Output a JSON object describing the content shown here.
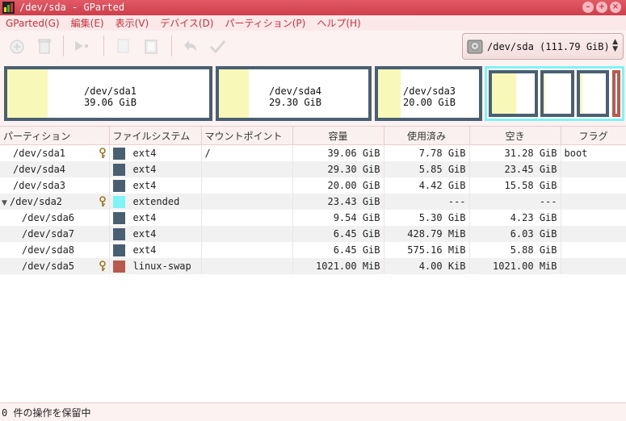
{
  "window": {
    "title": "/dev/sda - GParted"
  },
  "menu": [
    "GParted(G)",
    "編集(E)",
    "表示(V)",
    "デバイス(D)",
    "パーティション(P)",
    "ヘルプ(H)"
  ],
  "device_selector": {
    "value": "/dev/sda  (111.79 GiB)"
  },
  "map": {
    "sda1": {
      "name": "/dev/sda1",
      "size": "39.06 GiB",
      "used_fraction": 0.2
    },
    "sda4": {
      "name": "/dev/sda4",
      "size": "29.30 GiB",
      "used_fraction": 0.2
    },
    "sda3": {
      "name": "/dev/sda3",
      "size": "20.00 GiB",
      "used_fraction": 0.22
    }
  },
  "table": {
    "headers": [
      "パーティション",
      "ファイルシステム",
      "マウントポイント",
      "容量",
      "使用済み",
      "空き",
      "フラグ"
    ],
    "rows": [
      {
        "partition": "/dev/sda1",
        "fs": "ext4",
        "mount": "/",
        "size": "39.06 GiB",
        "used": "7.78 GiB",
        "free": "31.28 GiB",
        "flags": "boot"
      },
      {
        "partition": "/dev/sda4",
        "fs": "ext4",
        "mount": "",
        "size": "29.30 GiB",
        "used": "5.85 GiB",
        "free": "23.45 GiB",
        "flags": ""
      },
      {
        "partition": "/dev/sda3",
        "fs": "ext4",
        "mount": "",
        "size": "20.00 GiB",
        "used": "4.42 GiB",
        "free": "15.58 GiB",
        "flags": ""
      },
      {
        "partition": "/dev/sda2",
        "fs": "extended",
        "mount": "",
        "size": "23.43 GiB",
        "used": "---",
        "free": "---",
        "flags": ""
      },
      {
        "partition": "/dev/sda6",
        "fs": "ext4",
        "mount": "",
        "size": "9.54 GiB",
        "used": "5.30 GiB",
        "free": "4.23 GiB",
        "flags": ""
      },
      {
        "partition": "/dev/sda7",
        "fs": "ext4",
        "mount": "",
        "size": "6.45 GiB",
        "used": "428.79 MiB",
        "free": "6.03 GiB",
        "flags": ""
      },
      {
        "partition": "/dev/sda8",
        "fs": "ext4",
        "mount": "",
        "size": "6.45 GiB",
        "used": "575.16 MiB",
        "free": "5.88 GiB",
        "flags": ""
      },
      {
        "partition": "/dev/sda5",
        "fs": "linux-swap",
        "mount": "",
        "size": "1021.00 MiB",
        "used": "4.00 KiB",
        "free": "1021.00 MiB",
        "flags": ""
      }
    ]
  },
  "colors": {
    "ext4": "#4a5f72",
    "extended": "#7ff3f5",
    "linux_swap": "#b85a4e",
    "used": "#f8f8b8",
    "accent": "#cf3f4c"
  },
  "status": {
    "text": "0 件の操作を保留中"
  }
}
